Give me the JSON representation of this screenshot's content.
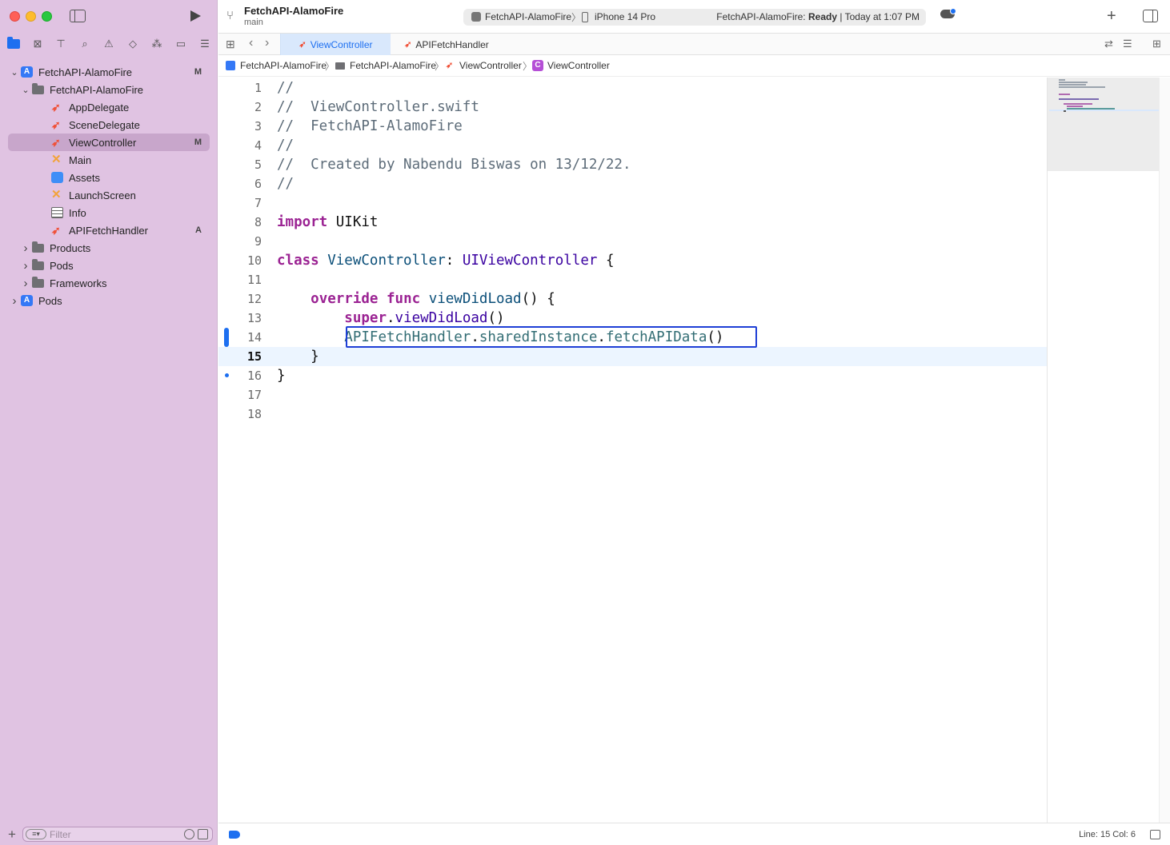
{
  "toolbar": {
    "project_title": "FetchAPI-AlamoFire",
    "branch": "main",
    "scheme": "FetchAPI-AlamoFire",
    "scheme_separator": "〉",
    "device": "iPhone 14 Pro",
    "status_project": "FetchAPI-AlamoFire:",
    "status_state": "Ready",
    "status_time": "| Today at 1:07 PM",
    "plus_label": "+"
  },
  "tabs": [
    {
      "label": "ViewController",
      "active": true
    },
    {
      "label": "APIFetchHandler",
      "active": false
    }
  ],
  "breadcrumb": {
    "items": [
      "FetchAPI-AlamoFire",
      "FetchAPI-AlamoFire",
      "ViewController",
      "ViewController"
    ],
    "separator": "〉",
    "class_icon": "C"
  },
  "navigator": {
    "items": [
      {
        "label": "FetchAPI-AlamoFire",
        "icon": "app-project-icon",
        "level": 0,
        "expanded": true,
        "badge": "M"
      },
      {
        "label": "FetchAPI-AlamoFire",
        "icon": "folder-icon",
        "level": 1,
        "expanded": true,
        "badge": ""
      },
      {
        "label": "AppDelegate",
        "icon": "swift-file-icon",
        "level": 2,
        "badge": ""
      },
      {
        "label": "SceneDelegate",
        "icon": "swift-file-icon",
        "level": 2,
        "badge": ""
      },
      {
        "label": "ViewController",
        "icon": "swift-file-icon",
        "level": 2,
        "badge": "M",
        "selected": true
      },
      {
        "label": "Main",
        "icon": "storyboard-icon",
        "level": 2,
        "badge": ""
      },
      {
        "label": "Assets",
        "icon": "assets-icon",
        "level": 2,
        "badge": ""
      },
      {
        "label": "LaunchScreen",
        "icon": "storyboard-icon",
        "level": 2,
        "badge": ""
      },
      {
        "label": "Info",
        "icon": "plist-icon",
        "level": 2,
        "badge": ""
      },
      {
        "label": "APIFetchHandler",
        "icon": "swift-file-icon",
        "level": 2,
        "badge": "A"
      },
      {
        "label": "Products",
        "icon": "folder-icon",
        "level": 1,
        "expanded": false,
        "badge": ""
      },
      {
        "label": "Pods",
        "icon": "folder-icon",
        "level": 1,
        "expanded": false,
        "badge": ""
      },
      {
        "label": "Frameworks",
        "icon": "folder-icon",
        "level": 1,
        "expanded": false,
        "badge": ""
      },
      {
        "label": "Pods",
        "icon": "app-project-icon",
        "level": 0,
        "expanded": false,
        "badge": ""
      }
    ],
    "filter_placeholder": "Filter",
    "filter_add": "+"
  },
  "editor": {
    "line_numbers": [
      "1",
      "2",
      "3",
      "4",
      "5",
      "6",
      "7",
      "8",
      "9",
      "10",
      "11",
      "12",
      "13",
      "14",
      "15",
      "16",
      "17",
      "18"
    ],
    "current_line": 15,
    "lines": [
      [
        {
          "t": "//",
          "c": "com"
        }
      ],
      [
        {
          "t": "//  ViewController.swift",
          "c": "com"
        }
      ],
      [
        {
          "t": "//  FetchAPI-AlamoFire",
          "c": "com"
        }
      ],
      [
        {
          "t": "//",
          "c": "com"
        }
      ],
      [
        {
          "t": "//  Created by Nabendu Biswas on 13/12/22.",
          "c": "com"
        }
      ],
      [
        {
          "t": "//",
          "c": "com"
        }
      ],
      [],
      [
        {
          "t": "import",
          "c": "kw"
        },
        {
          "t": " UIKit",
          "c": ""
        }
      ],
      [],
      [
        {
          "t": "class",
          "c": "kw"
        },
        {
          "t": " ",
          "c": ""
        },
        {
          "t": "ViewController",
          "c": "cls"
        },
        {
          "t": ": ",
          "c": ""
        },
        {
          "t": "UIViewController",
          "c": "type"
        },
        {
          "t": " {",
          "c": ""
        }
      ],
      [],
      [
        {
          "t": "    ",
          "c": ""
        },
        {
          "t": "override",
          "c": "kw"
        },
        {
          "t": " ",
          "c": ""
        },
        {
          "t": "func",
          "c": "kw"
        },
        {
          "t": " ",
          "c": ""
        },
        {
          "t": "viewDidLoad",
          "c": "cls"
        },
        {
          "t": "() {",
          "c": ""
        }
      ],
      [
        {
          "t": "        ",
          "c": ""
        },
        {
          "t": "super",
          "c": "kw"
        },
        {
          "t": ".",
          "c": ""
        },
        {
          "t": "viewDidLoad",
          "c": "api"
        },
        {
          "t": "()",
          "c": ""
        }
      ],
      [
        {
          "t": "        ",
          "c": ""
        },
        {
          "t": "APIFetchHandler",
          "c": "fn"
        },
        {
          "t": ".",
          "c": ""
        },
        {
          "t": "sharedInstance",
          "c": "fn"
        },
        {
          "t": ".",
          "c": ""
        },
        {
          "t": "fetchAPIData",
          "c": "fn"
        },
        {
          "t": "()",
          "c": ""
        }
      ],
      [
        {
          "t": "    }",
          "c": ""
        }
      ],
      [
        {
          "t": "}",
          "c": ""
        }
      ],
      [],
      []
    ]
  },
  "statusbar": {
    "position": "Line: 15  Col: 6"
  },
  "colors": {
    "sidebar_bg": "#e0c3e2",
    "accent": "#1d6ff0",
    "highlight_box": "#1e3fd6"
  }
}
